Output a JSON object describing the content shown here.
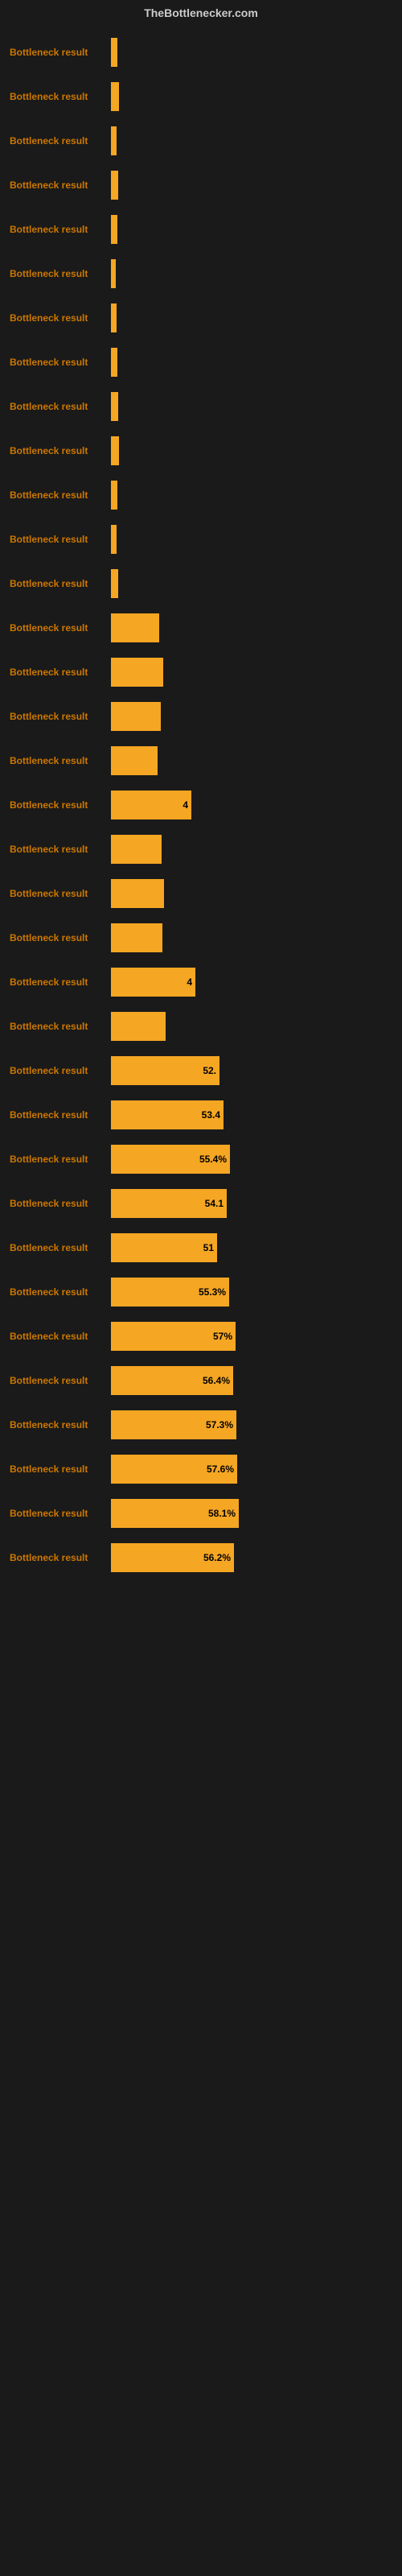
{
  "header": {
    "title": "TheBottlenecker.com"
  },
  "rows": [
    {
      "label": "Bottleneck result",
      "value": null,
      "barWidth": 8
    },
    {
      "label": "Bottleneck result",
      "value": null,
      "barWidth": 10
    },
    {
      "label": "Bottleneck result",
      "value": null,
      "barWidth": 7
    },
    {
      "label": "Bottleneck result",
      "value": null,
      "barWidth": 9
    },
    {
      "label": "Bottleneck result",
      "value": null,
      "barWidth": 8
    },
    {
      "label": "Bottleneck result",
      "value": null,
      "barWidth": 6
    },
    {
      "label": "Bottleneck result",
      "value": null,
      "barWidth": 7
    },
    {
      "label": "Bottleneck result",
      "value": null,
      "barWidth": 8
    },
    {
      "label": "Bottleneck result",
      "value": null,
      "barWidth": 9
    },
    {
      "label": "Bottleneck result",
      "value": null,
      "barWidth": 10
    },
    {
      "label": "Bottleneck result",
      "value": null,
      "barWidth": 8
    },
    {
      "label": "Bottleneck result",
      "value": null,
      "barWidth": 7
    },
    {
      "label": "Bottleneck result",
      "value": null,
      "barWidth": 9
    },
    {
      "label": "Bottleneck result",
      "value": null,
      "barWidth": 60
    },
    {
      "label": "Bottleneck result",
      "value": null,
      "barWidth": 65
    },
    {
      "label": "Bottleneck result",
      "value": null,
      "barWidth": 62
    },
    {
      "label": "Bottleneck result",
      "value": null,
      "barWidth": 58
    },
    {
      "label": "Bottleneck result",
      "value": "4",
      "barWidth": 100
    },
    {
      "label": "Bottleneck result",
      "value": null,
      "barWidth": 63
    },
    {
      "label": "Bottleneck result",
      "value": null,
      "barWidth": 66
    },
    {
      "label": "Bottleneck result",
      "value": null,
      "barWidth": 64
    },
    {
      "label": "Bottleneck result",
      "value": "4",
      "barWidth": 105
    },
    {
      "label": "Bottleneck result",
      "value": null,
      "barWidth": 68
    },
    {
      "label": "Bottleneck result",
      "value": "52.",
      "barWidth": 135
    },
    {
      "label": "Bottleneck result",
      "value": "53.4",
      "barWidth": 140
    },
    {
      "label": "Bottleneck result",
      "value": "55.4%",
      "barWidth": 148
    },
    {
      "label": "Bottleneck result",
      "value": "54.1",
      "barWidth": 144
    },
    {
      "label": "Bottleneck result",
      "value": "51",
      "barWidth": 132
    },
    {
      "label": "Bottleneck result",
      "value": "55.3%",
      "barWidth": 147
    },
    {
      "label": "Bottleneck result",
      "value": "57%",
      "barWidth": 155
    },
    {
      "label": "Bottleneck result",
      "value": "56.4%",
      "barWidth": 152
    },
    {
      "label": "Bottleneck result",
      "value": "57.3%",
      "barWidth": 156
    },
    {
      "label": "Bottleneck result",
      "value": "57.6%",
      "barWidth": 157
    },
    {
      "label": "Bottleneck result",
      "value": "58.1%",
      "barWidth": 159
    },
    {
      "label": "Bottleneck result",
      "value": "56.2%",
      "barWidth": 153
    }
  ]
}
